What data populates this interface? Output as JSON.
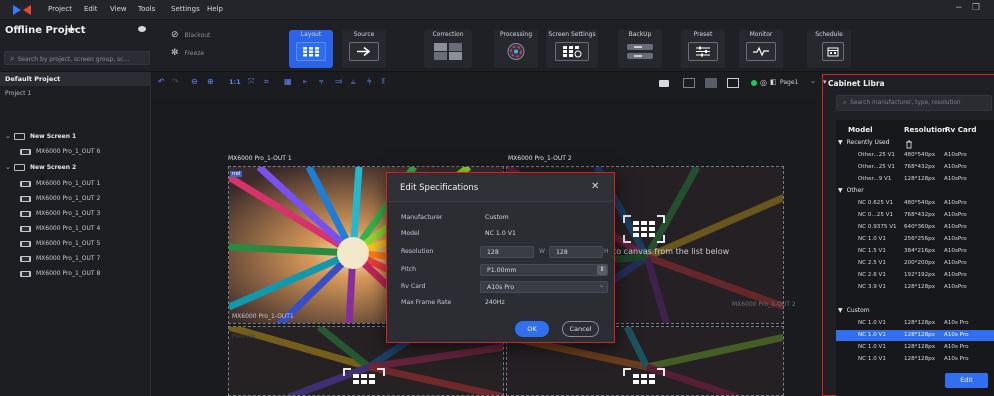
{
  "menu": {
    "items": [
      "Project",
      "Edit",
      "View",
      "Tools",
      "Settings",
      "Help"
    ],
    "window_min": "−",
    "window_max": "❐"
  },
  "project": {
    "title": "Offline Project",
    "add": "+",
    "search_placeholder": "Search by project, screen group, sc..."
  },
  "ribbon": {
    "blackout_label": "Blackout",
    "freeze_label": "Freeze",
    "tools": [
      {
        "label": "Layout",
        "icon": "layout-icon",
        "active": true
      },
      {
        "label": "Source",
        "icon": "source-icon",
        "active": false
      },
      {
        "label": "Correction",
        "icon": "correction-icon",
        "active": false
      },
      {
        "label": "Processing",
        "icon": "processing-icon",
        "active": false
      },
      {
        "label": "Screen Settings",
        "icon": "screen-settings-icon",
        "active": false
      },
      {
        "label": "BackUp",
        "icon": "backup-icon",
        "active": false
      },
      {
        "label": "Preset",
        "icon": "preset-icon",
        "active": false
      },
      {
        "label": "Monitor",
        "icon": "monitor-icon",
        "active": false
      },
      {
        "label": "Schedule",
        "icon": "schedule-icon",
        "active": false
      }
    ],
    "accent": "#2d6df6"
  },
  "tree": {
    "default_project": "Default Project",
    "project_1": "Project 1",
    "screens": [
      {
        "label": "New Screen 1",
        "outputs": [
          "MX6000 Pro_1_OUT 6"
        ]
      },
      {
        "label": "New Screen 2",
        "outputs": [
          "MX6000 Pro_1_OUT 1",
          "MX6000 Pro_1_OUT 2",
          "MX6000 Pro_1_OUT 3",
          "MX6000 Pro_1_OUT 4",
          "MX6000 Pro_1_OUT 5",
          "MX6000 Pro_1_OUT 7",
          "MX6000 Pro_1_OUT 8"
        ]
      }
    ]
  },
  "canvas_toolbar": {
    "ratio": "1:1",
    "page": "Page1"
  },
  "canvas": {
    "cabinet_1_label": "MX6000 Pro_1-OUT 1",
    "cabinet_2_label": "MX6000 Pro_1-OUT 2",
    "drop_hint": "pinets to canvas from the list below",
    "inner_label_1": "MX6000 Pro_1-OUT1",
    "inner_label_2": "MX6000 Pro_1-OUT 2",
    "inner_tag": "nel",
    "preview_tag": "Preview"
  },
  "dialog": {
    "title": "Edit Specifications",
    "close": "✕",
    "fields": {
      "manufacturer_label": "Manufacturer",
      "manufacturer_value": "Custom",
      "model_label": "Model",
      "model_value": "NC 1.0 V1",
      "resolution_label": "Resolution",
      "resolution_w": "128",
      "resolution_x": "W",
      "resolution_h": "128",
      "resolution_px": "H",
      "pitch_label": "Pitch",
      "pitch_value": "P1.00mm",
      "rv_card_label": "Rv Card",
      "rv_card_value": "A10s Pro",
      "max_frame_rate_label": "Max Frame Rate",
      "max_frame_rate_value": "240Hz"
    },
    "ok_label": "OK",
    "cancel_label": "Cancel"
  },
  "library": {
    "title": "Cabinet Libra",
    "search_placeholder": "Search manufacturer, type, resolution",
    "columns": [
      "Model",
      "Resolution",
      "Rv Card"
    ],
    "groups": [
      {
        "label": "Recently Used",
        "rows": [
          {
            "model": "Other...25 V1",
            "resolution": "480*540px",
            "rv": "A10sPro",
            "selected": false
          },
          {
            "model": "Other...25 V1",
            "resolution": "768*432px",
            "rv": "A10sPro",
            "selected": false
          },
          {
            "model": "Other...9 V1",
            "resolution": "128*128px",
            "rv": "A10sPro",
            "selected": false
          }
        ]
      },
      {
        "label": "Other",
        "rows": [
          {
            "model": "NC 0.625 V1",
            "resolution": "480*540px",
            "rv": "A10sPro",
            "selected": false
          },
          {
            "model": "NC 0...25 V1",
            "resolution": "768*432px",
            "rv": "A10sPro",
            "selected": false
          },
          {
            "model": "NC 0.9375 V1",
            "resolution": "640*360px",
            "rv": "A10sPro",
            "selected": false
          },
          {
            "model": "NC 1.0 V1",
            "resolution": "256*256px",
            "rv": "A10sPro",
            "selected": false
          },
          {
            "model": "NC 1.5 V1",
            "resolution": "384*216px",
            "rv": "A10sPro",
            "selected": false
          },
          {
            "model": "NC 2.5 V1",
            "resolution": "200*200px",
            "rv": "A10sPro",
            "selected": false
          },
          {
            "model": "NC 2.6 V1",
            "resolution": "192*192px",
            "rv": "A10sPro",
            "selected": false
          },
          {
            "model": "NC 3.9 V1",
            "resolution": "128*128px",
            "rv": "A10sPro",
            "selected": false
          }
        ]
      },
      {
        "label": "Custom",
        "rows": [
          {
            "model": "NC 1.0 V1",
            "resolution": "128*128px",
            "rv": "A10s Pro",
            "selected": false
          },
          {
            "model": "NC 1.0 V1",
            "resolution": "128*128px",
            "rv": "A10s Pro",
            "selected": true
          },
          {
            "model": "NC 1.0 V1",
            "resolution": "128*128px",
            "rv": "A10s Pro",
            "selected": false
          },
          {
            "model": "NC 1.0 V1",
            "resolution": "128*128px",
            "rv": "A10s Pro",
            "selected": false
          }
        ]
      }
    ],
    "edit_label": "Edit"
  }
}
